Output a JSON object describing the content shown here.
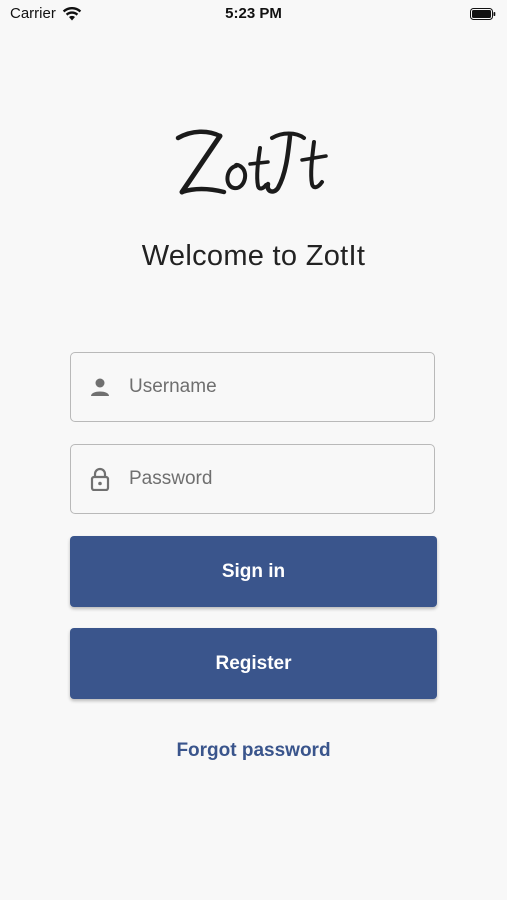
{
  "status_bar": {
    "carrier": "Carrier",
    "time": "5:23 PM"
  },
  "logo": {
    "text": "ZotIt"
  },
  "welcome_title": "Welcome to ZotIt",
  "username": {
    "value": "",
    "placeholder": "Username",
    "icon": "person-icon"
  },
  "password": {
    "value": "",
    "placeholder": "Password",
    "icon": "lock-icon"
  },
  "buttons": {
    "sign_in": "Sign in",
    "register": "Register"
  },
  "forgot_password": "Forgot password",
  "colors": {
    "accent": "#3a558c",
    "background": "#f8f8f8",
    "field_border": "#b9b9b9",
    "placeholder": "#6f6f6f"
  }
}
